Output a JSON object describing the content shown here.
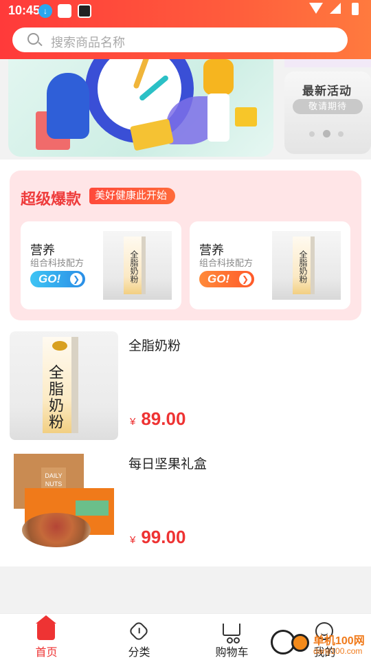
{
  "status_bar": {
    "time": "10:45"
  },
  "search": {
    "placeholder": "搜索商品名称"
  },
  "side_card": {
    "title": "最新活动",
    "pill": "敬请期待"
  },
  "section": {
    "title": "超级爆款",
    "tag": "美好健康此开始",
    "promos": [
      {
        "title": "营养",
        "subtitle": "组合科技配方",
        "button": "GO!",
        "color": "blue",
        "box_text": "全脂奶粉"
      },
      {
        "title": "营养",
        "subtitle": "组合科技配方",
        "button": "GO!",
        "color": "orange",
        "box_text": "全脂奶粉"
      }
    ]
  },
  "products": [
    {
      "name": "全脂奶粉",
      "currency": "¥",
      "price": "89.00",
      "box_text": "全脂奶粉"
    },
    {
      "name": "每日坚果礼盒",
      "currency": "¥",
      "price": "99.00",
      "box_text": "DAILY NUTS"
    }
  ],
  "tabbar": {
    "tabs": [
      {
        "label": "首页",
        "icon": "home-icon",
        "active": true
      },
      {
        "label": "分类",
        "icon": "category-icon",
        "active": false
      },
      {
        "label": "购物车",
        "icon": "cart-icon",
        "active": false
      },
      {
        "label": "我的",
        "icon": "profile-icon",
        "active": false
      }
    ]
  },
  "watermark": {
    "text": "单机100网",
    "url": "danji100.com"
  },
  "colors": {
    "accent": "#ee3333",
    "header_start": "#ff3a3a",
    "header_end": "#ff7a3e",
    "section_bg": "#ffe5e7"
  }
}
